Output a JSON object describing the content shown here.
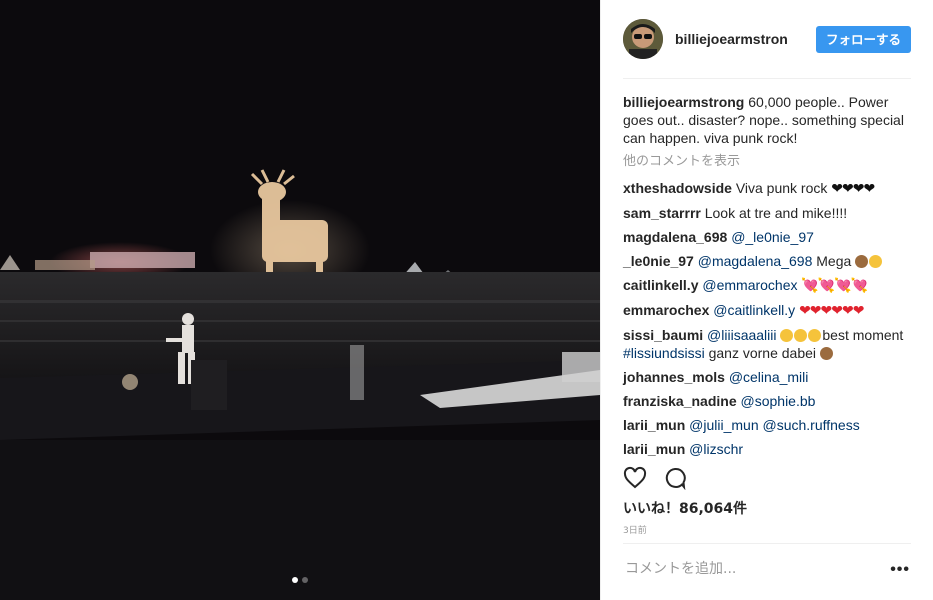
{
  "post": {
    "author": "billiejoearmstron",
    "follow_label": "フォローする",
    "caption": {
      "user": "billiejoearmstrong",
      "text": "60,000 people.. Power goes out.. disaster? nope.. something special can happen. viva punk rock!"
    },
    "more_comments": "他のコメントを表示",
    "comments": [
      {
        "user": "xtheshadowside",
        "text": "Viva punk rock ",
        "emoji": "❤❤❤❤"
      },
      {
        "user": "sam_starrrr",
        "text": "Look at tre and mike!!!!"
      },
      {
        "user": "magdalena_698",
        "mention": "@_le0nie_97"
      },
      {
        "user": "_le0nie_97",
        "mention": "@magdalena_698",
        "text": " Mega"
      },
      {
        "user": "caitlinkell.y",
        "mention": "@emmarochex",
        "emoji": "💘💘💘💘"
      },
      {
        "user": "emmarochex",
        "mention": "@caitlinkell.y",
        "emoji": "❤❤❤❤❤❤"
      },
      {
        "user": "sissi_baumi",
        "mention": "@liiisaaaliii",
        "text": "best moment ",
        "hashtag": "#lissiundsissi",
        "text2": " ganz vorne dabei"
      },
      {
        "user": "johannes_mols",
        "mention": "@celina_mili"
      },
      {
        "user": "franziska_nadine",
        "mention": "@sophie.bb"
      },
      {
        "user": "larii_mun",
        "mention": "@julii_mun",
        "mention2": "@such.ruffness"
      },
      {
        "user": "larii_mun",
        "mention": "@lizschr"
      }
    ],
    "likes": "いいね！86,064件",
    "time": "3日前",
    "comment_placeholder": "コメントを追加...",
    "options": "•••",
    "carousel": {
      "count": 2,
      "active": 0
    }
  }
}
